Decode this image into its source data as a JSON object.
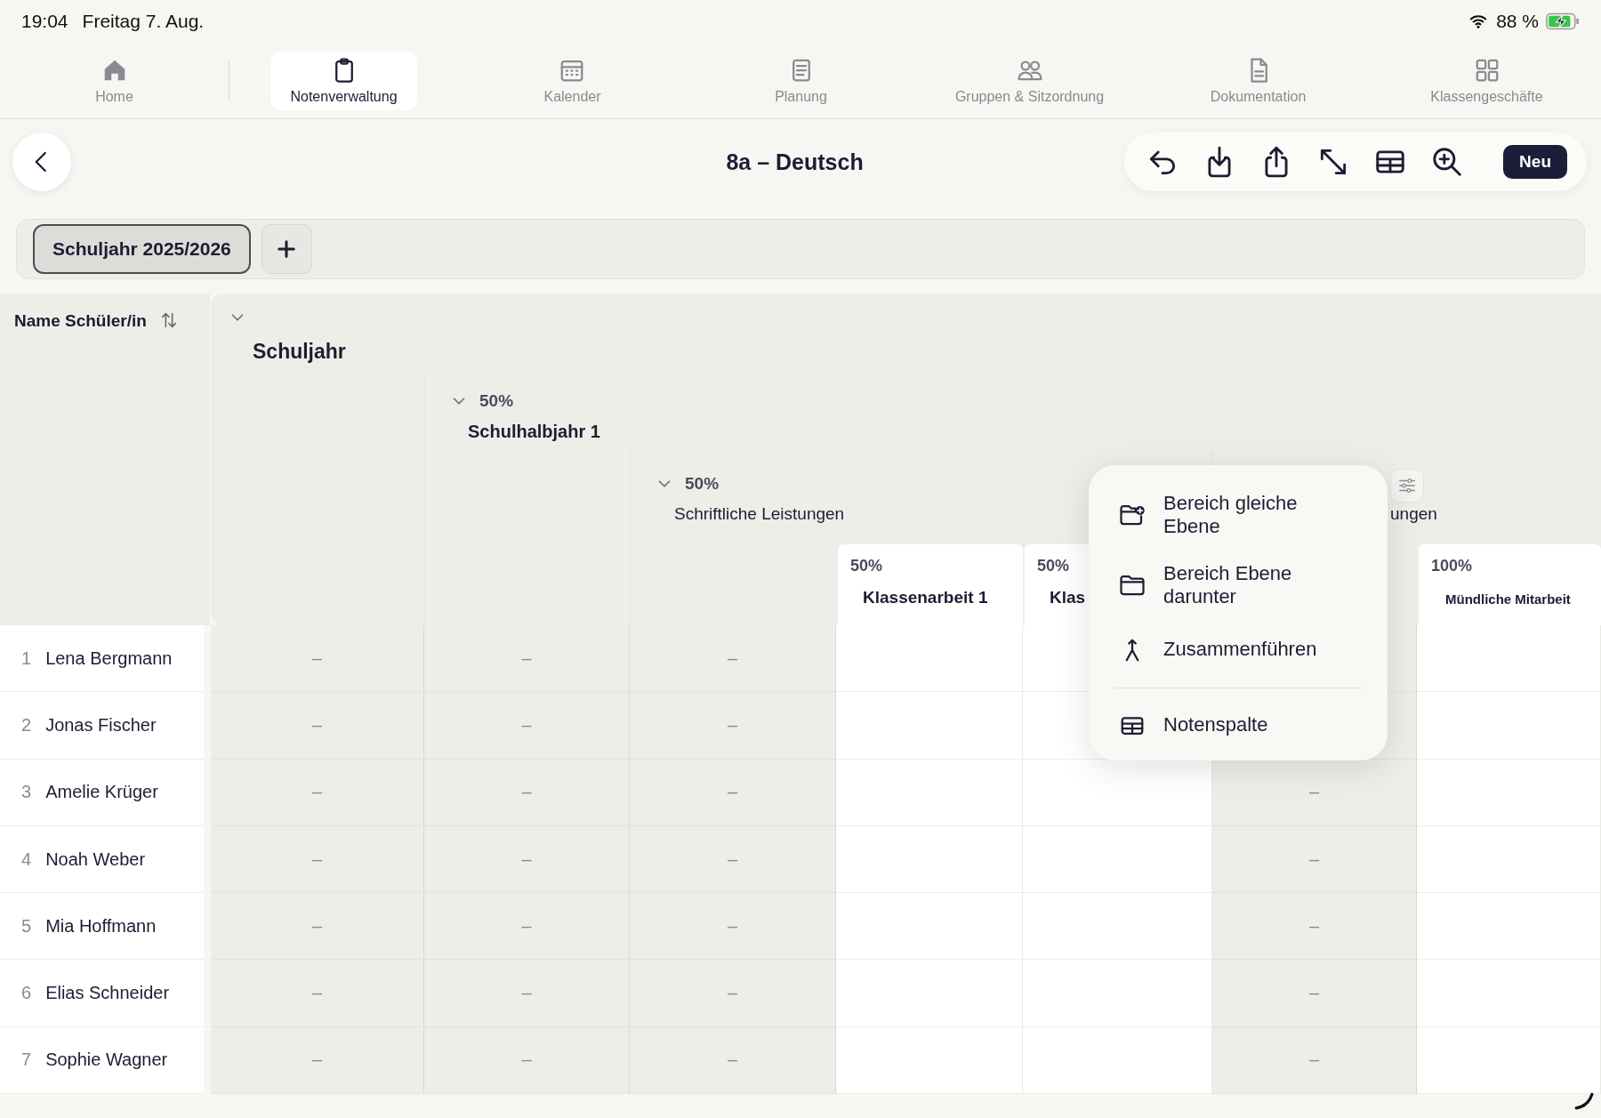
{
  "status_bar": {
    "time": "19:04",
    "date": "Freitag 7. Aug.",
    "battery": "88 %",
    "charging": true
  },
  "tabs": [
    {
      "kind": "home",
      "label": "Home",
      "selected": false
    },
    {
      "kind": "clipboard",
      "label": "Notenverwaltung",
      "selected": true
    },
    {
      "kind": "calendar",
      "label": "Kalender",
      "selected": false
    },
    {
      "kind": "notes",
      "label": "Planung",
      "selected": false
    },
    {
      "kind": "people",
      "label": "Gruppen & Sitzordnung",
      "selected": false
    },
    {
      "kind": "document",
      "label": "Dokumentation",
      "selected": false
    },
    {
      "kind": "grid",
      "label": "Klassengeschäfte",
      "selected": false
    }
  ],
  "header": {
    "title": "8a – Deutsch",
    "actions": [
      {
        "kind": "undo"
      },
      {
        "kind": "download"
      },
      {
        "kind": "share"
      },
      {
        "kind": "expand"
      },
      {
        "kind": "table"
      },
      {
        "kind": "zoom"
      }
    ],
    "primary_button": "Neu"
  },
  "year_tabs": [
    {
      "label": "Schuljahr 2025/2026",
      "selected": true
    }
  ],
  "table": {
    "name_header": "Name Schüler/in",
    "groups": [
      {
        "title": "Schuljahr",
        "expanded": true,
        "children": [
          {
            "weight": "50%",
            "title": "Schulhalbjahr 1",
            "expanded": true,
            "children": [
              {
                "weight": "50%",
                "title": "Schriftliche Leistungen",
                "expanded": true,
                "children": [
                  {
                    "weight": "50%",
                    "title": "Klassenarbeit 1"
                  },
                  {
                    "weight": "50%",
                    "title": "Klas"
                  }
                ]
              },
              {
                "title": "ungen",
                "filter_button": true,
                "children": [
                  {
                    "weight": "100%",
                    "title": "Mündliche Mitarbeit"
                  }
                ]
              }
            ]
          }
        ]
      }
    ],
    "rows": [
      {
        "number": "1",
        "name": "Lena Bergmann",
        "cells": [
          "–",
          "–",
          "–",
          null,
          null,
          null,
          null
        ]
      },
      {
        "number": "2",
        "name": "Jonas Fischer",
        "cells": [
          "–",
          "–",
          "–",
          null,
          null,
          null,
          null
        ]
      },
      {
        "number": "3",
        "name": "Amelie Krüger",
        "cells": [
          "–",
          "–",
          "–",
          null,
          null,
          "–",
          null
        ]
      },
      {
        "number": "4",
        "name": "Noah Weber",
        "cells": [
          "–",
          "–",
          "–",
          null,
          null,
          "–",
          null
        ]
      },
      {
        "number": "5",
        "name": "Mia Hoffmann",
        "cells": [
          "–",
          "–",
          "–",
          null,
          null,
          "–",
          null
        ]
      },
      {
        "number": "6",
        "name": "Elias Schneider",
        "cells": [
          "–",
          "–",
          "–",
          null,
          null,
          "–",
          null
        ]
      },
      {
        "number": "7",
        "name": "Sophie Wagner",
        "cells": [
          "–",
          "–",
          "–",
          null,
          null,
          "–",
          null
        ]
      }
    ]
  },
  "menu": {
    "items": [
      {
        "kind": "folder-plus",
        "label": "Bereich gleiche Ebene",
        "divider_before": false
      },
      {
        "kind": "folder",
        "label": "Bereich Ebene darunter",
        "divider_before": false
      },
      {
        "kind": "merge",
        "label": "Zusammenführen",
        "divider_before": false
      },
      {
        "kind": "table",
        "label": "Notenspalte",
        "divider_before": true
      }
    ]
  }
}
